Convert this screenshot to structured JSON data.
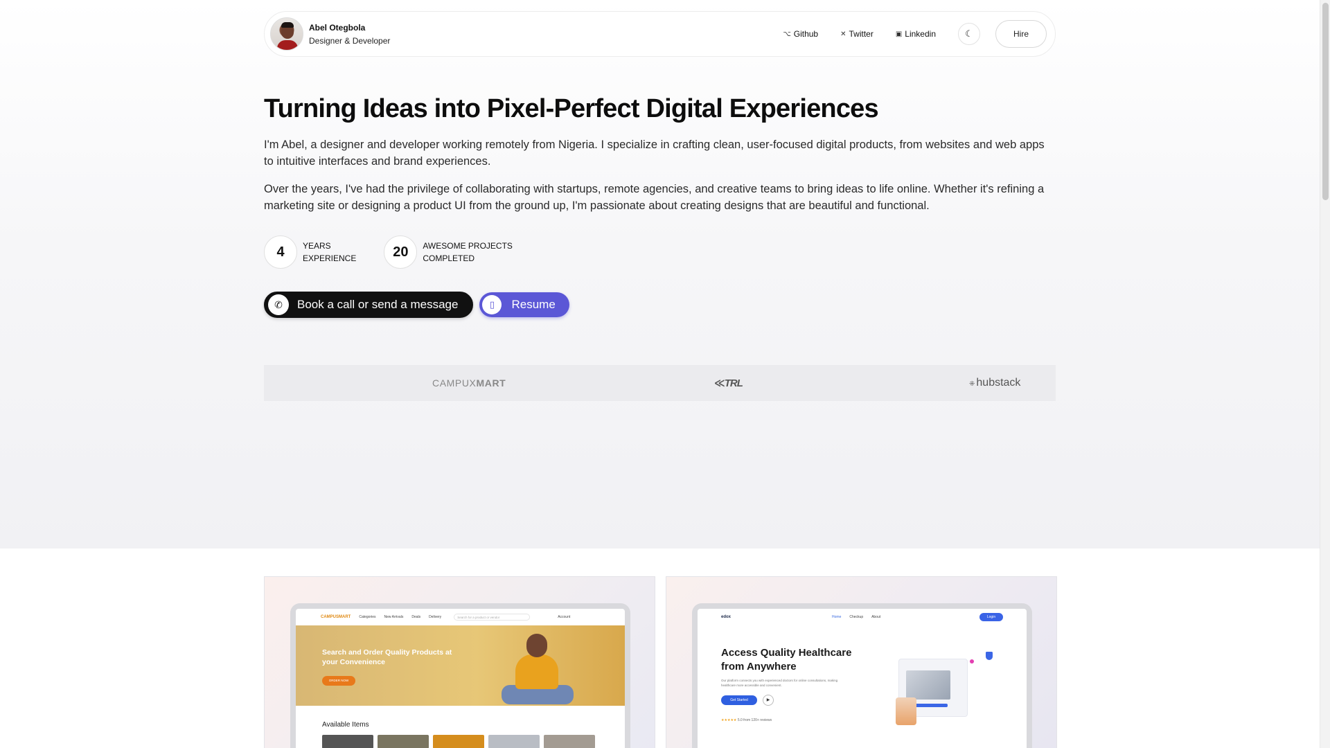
{
  "header": {
    "name": "Abel Otegbola",
    "role": "Designer & Developer",
    "nav": [
      {
        "label": "Github",
        "icon": "github-icon"
      },
      {
        "label": "Twitter",
        "icon": "x-icon"
      },
      {
        "label": "Linkedin",
        "icon": "linkedin-icon"
      }
    ],
    "theme_icon": "moon-icon",
    "hire_label": "Hire"
  },
  "hero": {
    "title": "Turning Ideas into Pixel-Perfect Digital Experiences",
    "paragraph1": "I'm Abel, a designer and developer working remotely from Nigeria. I specialize in crafting clean, user-focused digital products, from websites and web apps to intuitive interfaces and brand experiences.",
    "paragraph2": "Over the years, I've had the privilege of collaborating with startups, remote agencies, and creative teams to bring ideas to life online. Whether it's refining a marketing site or designing a product UI from the ground up, I'm passionate about creating designs that are beautiful and functional.",
    "stats": [
      {
        "number": "4",
        "line1": "Years",
        "line2": "Experience"
      },
      {
        "number": "20",
        "line1": "Awesome Projects",
        "line2": "Completed"
      }
    ],
    "cta_primary": "Book a call or send a message",
    "cta_secondary": "Resume"
  },
  "logos": {
    "campux_light": "CAMPUX",
    "campux_bold": "MART",
    "tt": "TRL",
    "hubstack": "hubstack"
  },
  "projects": {
    "campusmart": {
      "logo": "CAMPUSMART",
      "nav_items": [
        "Categories",
        "New Arrivals",
        "Deals",
        "Delivery"
      ],
      "search_placeholder": "Search for a product or vendor",
      "account": "Account",
      "headline": "Search and Order Quality Products at your Convenience",
      "button": "ORDER NOW",
      "section": "Available Items"
    },
    "edox": {
      "logo": "edox",
      "tabs": [
        "Home",
        "Checkup",
        "About"
      ],
      "login": "Login",
      "headline": "Access Quality Healthcare from Anywhere",
      "subtext": "Our platform connects you with experienced doctors for online consultations, making healthcare more accessible and convenient.",
      "button": "Get Started",
      "rating": "★★★★★",
      "reviews": "5.0 from 120+ reviews"
    }
  },
  "colors": {
    "accent_purple": "#5b57d6",
    "dark": "#111111"
  }
}
